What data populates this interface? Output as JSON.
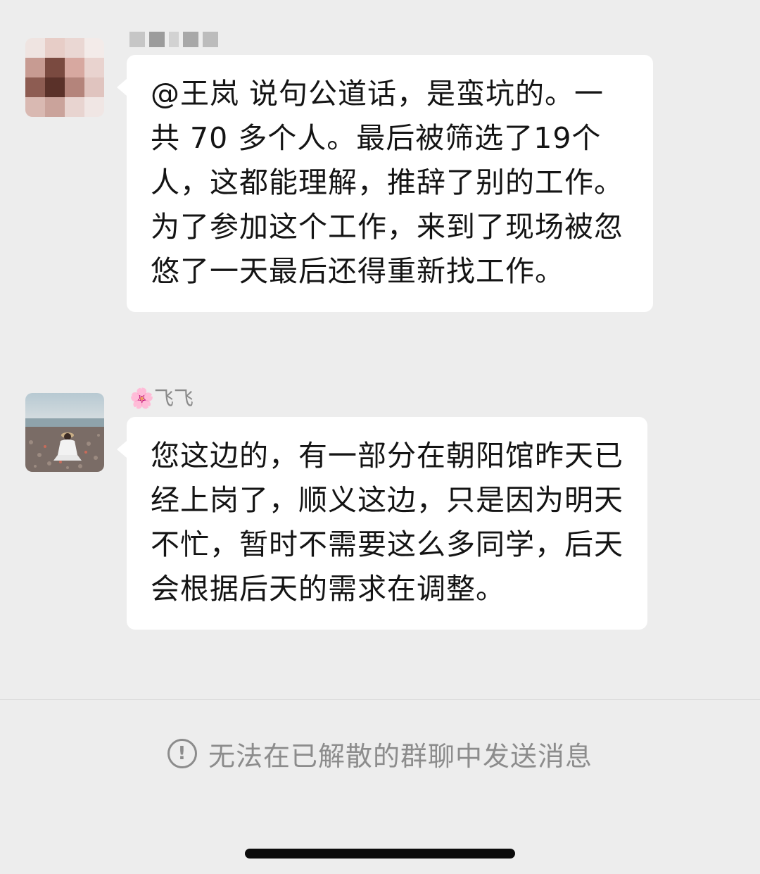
{
  "messages": [
    {
      "sender": "",
      "text": "@王岚 说句公道话，是蛮坑的。一共 70 多个人。最后被筛选了19个人，这都能理解，推辞了别的工作。为了参加这个工作，来到了现场被忽悠了一天最后还得重新找工作。"
    },
    {
      "sender": "🌸飞飞",
      "text": "您这边的，有一部分在朝阳馆昨天已经上岗了，顺义这边，只是因为明天不忙，暂时不需要这么多同学，后天会根据后天的需求在调整。"
    }
  ],
  "footer": {
    "notice_icon": "!",
    "notice_text": "无法在已解散的群聊中发送消息"
  },
  "colors": {
    "background": "#ededed",
    "bubble": "#ffffff",
    "name_text": "#8a8a8a",
    "notice_text": "#8c8c8c"
  }
}
